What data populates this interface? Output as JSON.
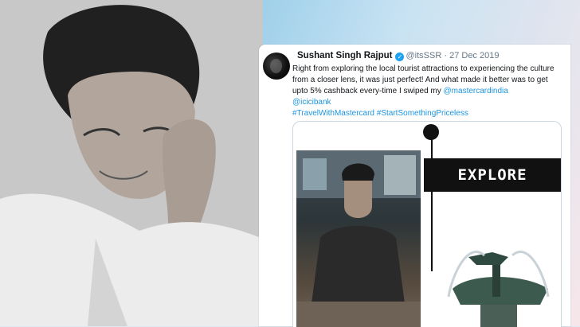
{
  "tweet": {
    "name": "Sushant Singh Rajput",
    "handle": "@itsSSR",
    "separator": "·",
    "date": "27 Dec 2019",
    "text_part1": "Right from exploring the local tourist attractions to experiencing the culture from a closer lens, it was just perfect! And what made it better was to get upto 5% cashback every-time I swiped my ",
    "mention1": "@mastercardindia",
    "mention2": "@icicibank",
    "hashtag1": "#TravelWithMastercard",
    "hashtag2": "#StartSomethingPriceless",
    "verified_icon": "check-badge",
    "image_text": "EXPLORE"
  },
  "colors": {
    "link": "#1b95e0",
    "verified": "#1da1f2"
  }
}
